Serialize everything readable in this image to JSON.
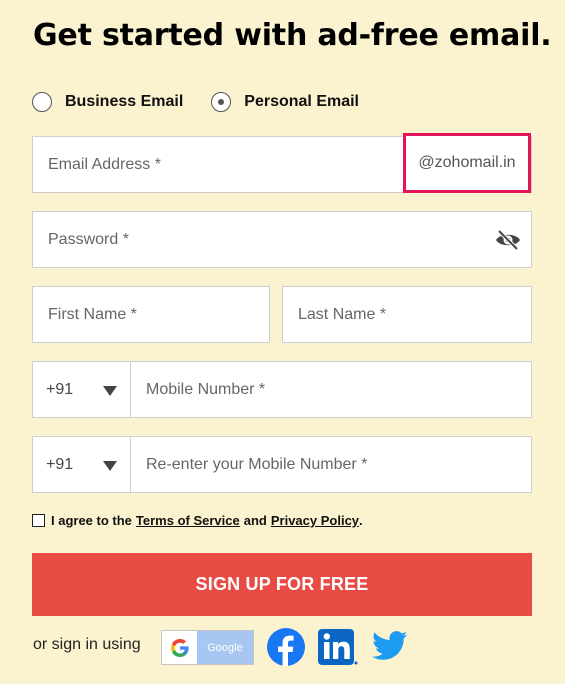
{
  "title": "Get started with ad-free email.",
  "account_type": {
    "options": [
      {
        "label": "Business Email",
        "selected": false
      },
      {
        "label": "Personal Email",
        "selected": true
      }
    ]
  },
  "form": {
    "email_placeholder": "Email Address *",
    "domain_suffix": "@zohomail.in",
    "password_placeholder": "Password *",
    "first_name_placeholder": "First Name *",
    "last_name_placeholder": "Last Name *",
    "country_code_1": "+91",
    "mobile_placeholder": "Mobile Number *",
    "country_code_2": "+91",
    "mobile_confirm_placeholder": "Re-enter your Mobile Number *"
  },
  "agreement": {
    "prefix": "I agree to the",
    "terms_label": "Terms of Service",
    "and": "and",
    "privacy_label": "Privacy Policy",
    "suffix": "."
  },
  "signup_label": "SIGN UP FOR FREE",
  "social": {
    "label": "or sign in using",
    "google_label": "Google",
    "icons": [
      "google-icon",
      "facebook-icon",
      "linkedin-icon",
      "twitter-icon"
    ]
  },
  "colors": {
    "background": "#fbf2cf",
    "signup_button": "#e74b44",
    "highlight_border": "#e4145b",
    "facebook": "#1877f2",
    "linkedin": "#0a66c2",
    "twitter": "#1d9bf0"
  }
}
